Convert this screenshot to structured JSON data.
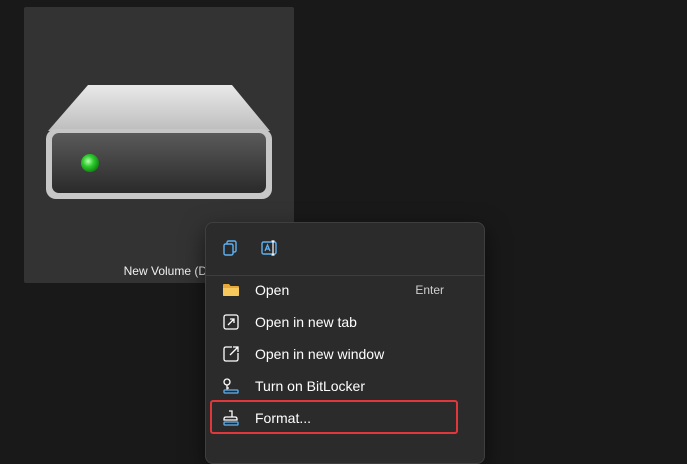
{
  "drive": {
    "label": "New Volume (D:)",
    "icon": "hard-drive-icon",
    "led_color": "#2ecc2e"
  },
  "context_menu": {
    "quick_actions": [
      {
        "icon": "copy-icon"
      },
      {
        "icon": "rename-icon"
      }
    ],
    "items": [
      {
        "label": "Open",
        "shortcut": "Enter",
        "icon": "folder-icon"
      },
      {
        "label": "Open in new tab",
        "icon": "open-new-tab-icon"
      },
      {
        "label": "Open in new window",
        "icon": "open-new-window-icon"
      },
      {
        "label": "Turn on BitLocker",
        "icon": "bitlocker-key-icon"
      },
      {
        "label": "Format...",
        "icon": "format-icon",
        "highlighted": true
      }
    ]
  },
  "colors": {
    "background": "#191919",
    "tile": "#333333",
    "menu": "#2b2b2b",
    "highlight_border": "#e0373a",
    "icon_blue": "#5fb2f2"
  }
}
